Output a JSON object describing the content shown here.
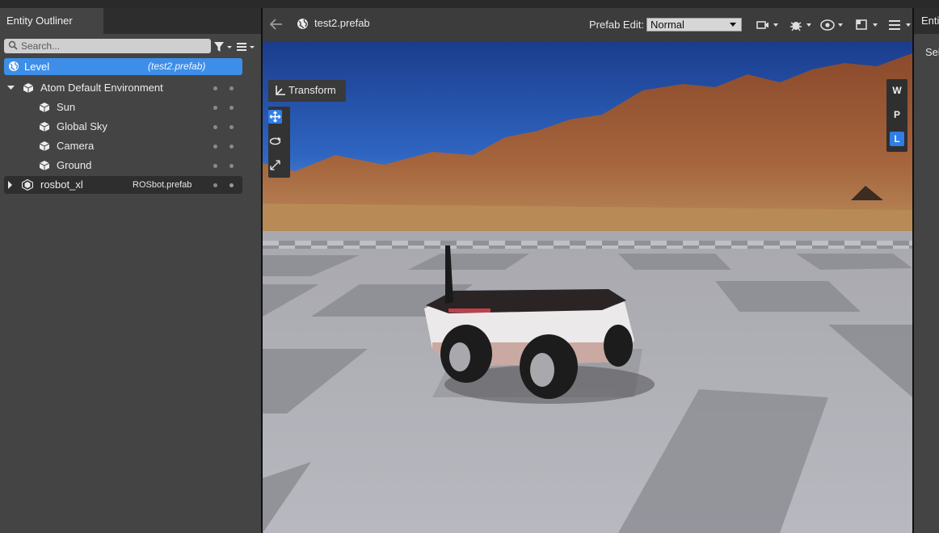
{
  "entity_outliner": {
    "tab_label": "Entity Outliner",
    "search": {
      "placeholder": "Search..."
    },
    "icons": {
      "search": "search-icon",
      "filter": "filter-icon",
      "menu": "hamburger-menu-icon"
    },
    "level": {
      "label": "Level",
      "subtitle": "(test2.prefab)"
    },
    "items": [
      {
        "label": "Atom Default Environment",
        "expandable": true,
        "expanded": true,
        "depth": 0
      },
      {
        "label": "Sun",
        "depth": 1
      },
      {
        "label": "Global Sky",
        "depth": 1
      },
      {
        "label": "Camera",
        "depth": 1
      },
      {
        "label": "Ground",
        "depth": 1
      }
    ],
    "prefab_item": {
      "label": "rosbot_xl",
      "subtitle": "ROSbot.prefab"
    }
  },
  "viewport": {
    "doc_title": "test2.prefab",
    "prefab_edit_label": "Prefab Edit:",
    "prefab_edit_value": "Normal",
    "transform_label": "Transform",
    "toolbar_icons": [
      "camera-icon",
      "debug-bug-icon",
      "visibility-eye-icon",
      "layout-icon",
      "hamburger-menu-icon"
    ],
    "tool_icons": [
      "move-icon",
      "rotate-icon",
      "scale-icon"
    ],
    "space_buttons": [
      {
        "label": "W",
        "active": false
      },
      {
        "label": "P",
        "active": false
      },
      {
        "label": "L",
        "active": true
      }
    ]
  },
  "inspector": {
    "tab_label": "Entity Inspector",
    "select_text": "Select an entity"
  },
  "colors": {
    "accent": "#3d8ee8",
    "panel": "#444444",
    "toolbar": "#3c3c3c"
  }
}
